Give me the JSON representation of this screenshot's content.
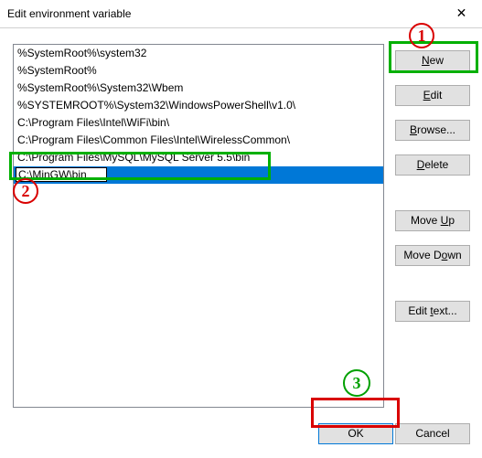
{
  "window": {
    "title": "Edit environment variable"
  },
  "list": {
    "items": [
      "%SystemRoot%\\system32",
      "%SystemRoot%",
      "%SystemRoot%\\System32\\Wbem",
      "%SYSTEMROOT%\\System32\\WindowsPowerShell\\v1.0\\",
      "C:\\Program Files\\Intel\\WiFi\\bin\\",
      "C:\\Program Files\\Common Files\\Intel\\WirelessCommon\\",
      "C:\\Program Files\\MySQL\\MySQL Server 5.5\\bin"
    ],
    "editing_value": "C:\\MinGW\\bin"
  },
  "buttons": {
    "new_u": "N",
    "new_rest": "ew",
    "edit_u": "E",
    "edit_rest": "dit",
    "browse_u": "B",
    "browse_rest": "rowse...",
    "delete_u": "D",
    "delete_rest": "elete",
    "moveup_pre": "Move ",
    "moveup_u": "U",
    "moveup_rest": "p",
    "movedown_pre": "Move D",
    "movedown_u": "o",
    "movedown_rest": "wn",
    "edittext_pre": "Edit ",
    "edittext_u": "t",
    "edittext_rest": "ext...",
    "ok": "OK",
    "cancel": "Cancel"
  },
  "annotations": {
    "one": "1",
    "two": "2",
    "three": "3"
  }
}
